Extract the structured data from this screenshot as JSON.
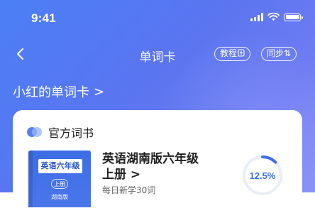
{
  "status_bar": {
    "time": "9:41"
  },
  "nav": {
    "title": "单词卡",
    "pill_jcb_label": "教程",
    "pill_tb_label": "同步⇅"
  },
  "deck": {
    "owner_title": "小红的单词卡",
    "chevron": ">"
  },
  "card": {
    "header_label": "官方词书",
    "book": {
      "cover_label": "英语六年级",
      "cover_volume": "上册",
      "cover_edition": "湖南版",
      "name_line1": "英语湖南版六年级",
      "name_line2": "上册",
      "chevron": ">",
      "subtitle": "每日新学30词",
      "progress_text": "12.5%",
      "progress_fraction": 0.125
    }
  },
  "colors": {
    "accent": "#3a6fe8",
    "gradient_start": "#4b7ff5",
    "gradient_end": "#8a94f6",
    "ring_track": "#e9edf7"
  },
  "icons": {
    "back": "back-chevron-icon",
    "signal": "cellular-signal-icon",
    "wifi": "wifi-icon",
    "battery": "battery-icon",
    "tutorial": "tutorial-badge-icon",
    "sync": "sync-arrows-icon",
    "header_dot": "dual-dot-icon"
  }
}
